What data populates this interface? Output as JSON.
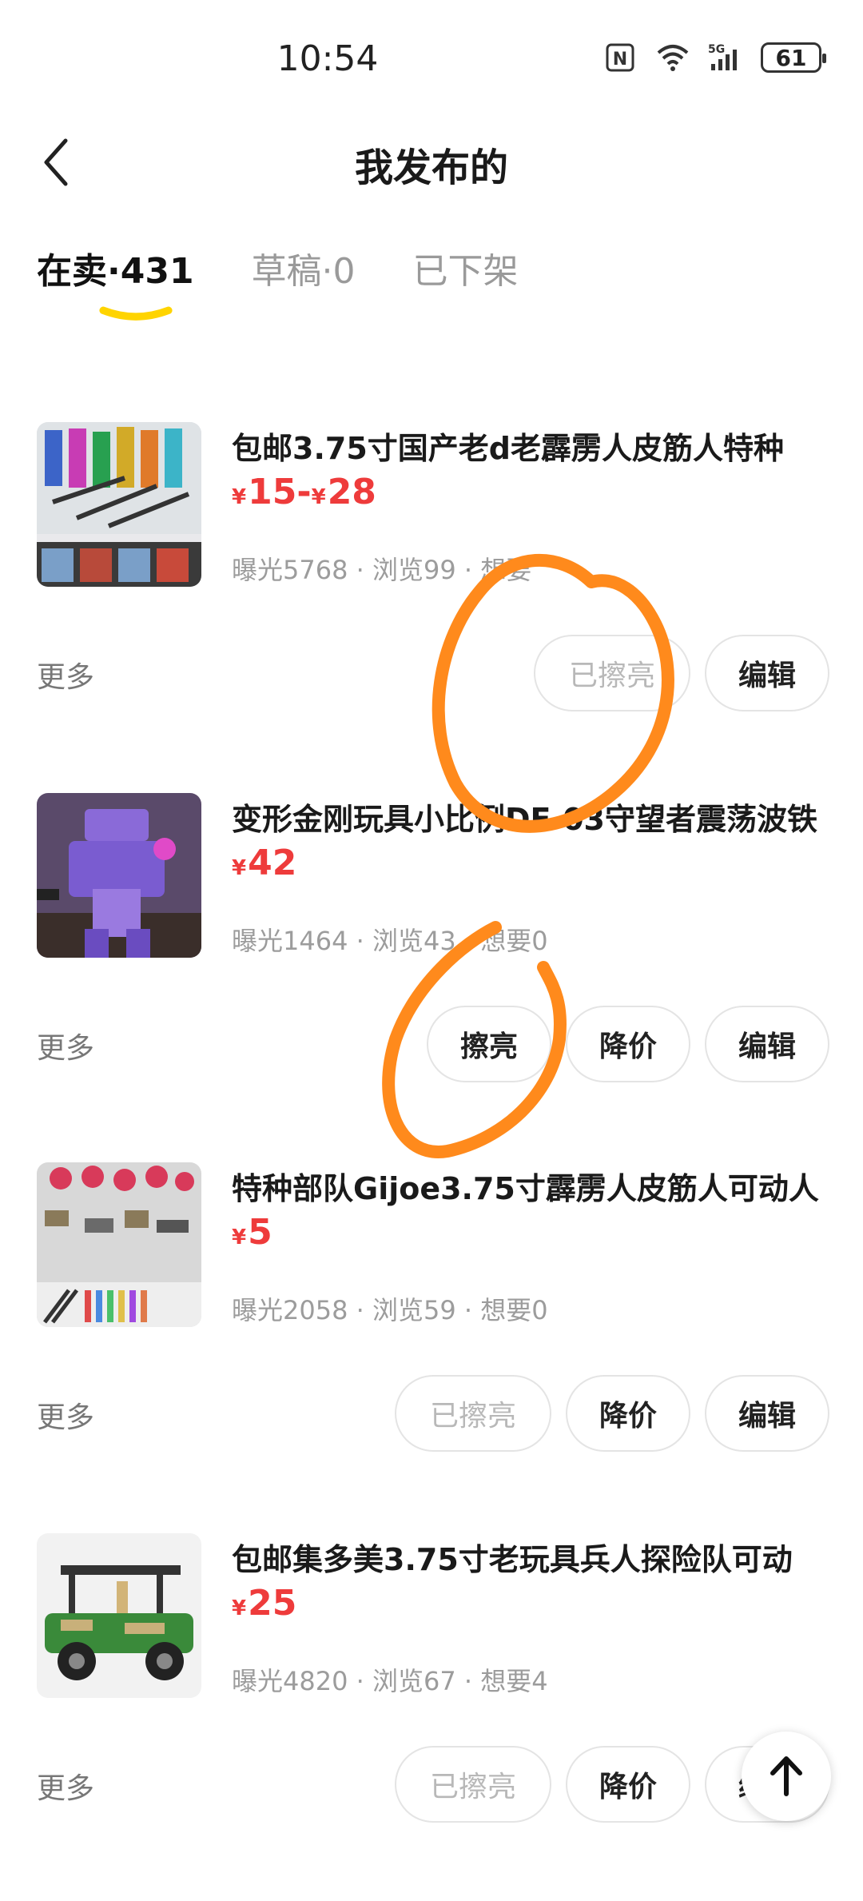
{
  "status_bar": {
    "time": "10:54",
    "battery": "61"
  },
  "header": {
    "title": "我发布的"
  },
  "tabs": [
    {
      "label": "在卖·431",
      "active": true
    },
    {
      "label": "草稿·0",
      "active": false
    },
    {
      "label": "已下架",
      "active": false
    }
  ],
  "items": [
    {
      "title": "包邮3.75寸国产老d老霹雳人皮筋人特种",
      "price_prefix": "¥",
      "price": "15",
      "price_sep": "-",
      "price_prefix2": "¥",
      "price_high": "28",
      "stats": "曝光5768 · 浏览99 · 想要",
      "more": "更多",
      "buttons": [
        "已擦亮",
        "编辑"
      ]
    },
    {
      "title": "变形金刚玩具小比例DF-03守望者震荡波铁",
      "price_prefix": "¥",
      "price": "42",
      "stats": "曝光1464 · 浏览43 · 想要0",
      "more": "更多",
      "buttons": [
        "擦亮",
        "降价",
        "编辑"
      ]
    },
    {
      "title": "特种部队Gijoe3.75寸霹雳人皮筋人可动人",
      "price_prefix": "¥",
      "price": "5",
      "stats": "曝光2058 · 浏览59 · 想要0",
      "more": "更多",
      "buttons": [
        "已擦亮",
        "降价",
        "编辑"
      ]
    },
    {
      "title": "包邮集多美3.75寸老玩具兵人探险队可动",
      "price_prefix": "¥",
      "price": "25",
      "stats": "曝光4820 · 浏览67 · 想要4",
      "more": "更多",
      "buttons": [
        "已擦亮",
        "降价",
        "编辑"
      ]
    }
  ],
  "colors": {
    "price": "#ee3b3b",
    "tab_underline": "#ffd400",
    "annotation": "#ff8a1c"
  }
}
